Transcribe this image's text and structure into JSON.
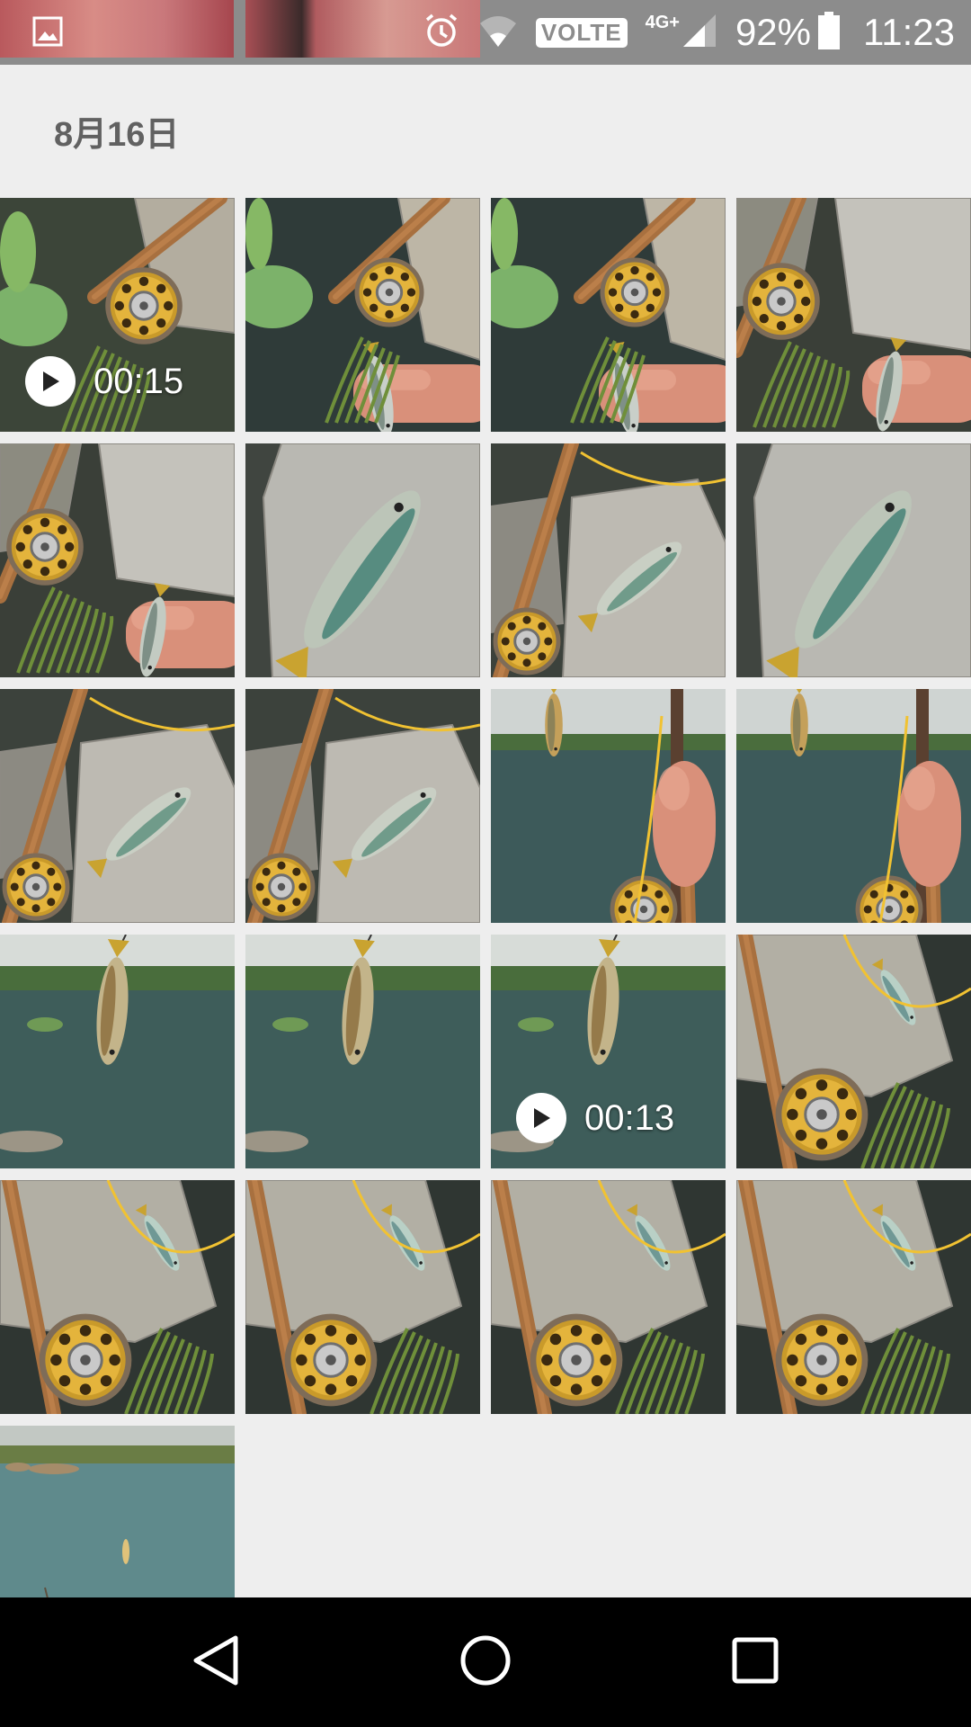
{
  "status_bar": {
    "left_icon": "image-icon",
    "volte_label": "VOLTE",
    "network_label": "4G+",
    "battery_percent": "92%",
    "time": "11:23",
    "icons": [
      "alarm-icon",
      "wifi-icon",
      "signal-icon",
      "battery-icon"
    ]
  },
  "gallery": {
    "date_header": "8月16日",
    "photos": [
      {
        "scene": "reel-plants",
        "video": true,
        "duration": "00:15"
      },
      {
        "scene": "reel-hand",
        "video": false,
        "duration": ""
      },
      {
        "scene": "reel-hand",
        "video": false,
        "duration": ""
      },
      {
        "scene": "reel-rock-hand",
        "video": false,
        "duration": ""
      },
      {
        "scene": "reel-rock-hand",
        "video": false,
        "duration": ""
      },
      {
        "scene": "fish-on-rock",
        "video": false,
        "duration": ""
      },
      {
        "scene": "rod-fish-rock",
        "video": false,
        "duration": ""
      },
      {
        "scene": "fish-on-rock",
        "video": false,
        "duration": ""
      },
      {
        "scene": "rod-fish-rock",
        "video": false,
        "duration": ""
      },
      {
        "scene": "rod-fish-rock",
        "video": false,
        "duration": ""
      },
      {
        "scene": "river-rod-hand",
        "video": false,
        "duration": ""
      },
      {
        "scene": "river-rod-hand",
        "video": false,
        "duration": ""
      },
      {
        "scene": "river-hanging-fish",
        "video": false,
        "duration": ""
      },
      {
        "scene": "river-hanging-fish",
        "video": false,
        "duration": ""
      },
      {
        "scene": "river-hanging-fish",
        "video": true,
        "duration": "00:13"
      },
      {
        "scene": "reel-rock-small-fish",
        "video": false,
        "duration": ""
      },
      {
        "scene": "reel-rock-small-fish",
        "video": false,
        "duration": ""
      },
      {
        "scene": "reel-rock-small-fish",
        "video": false,
        "duration": ""
      },
      {
        "scene": "reel-rock-small-fish",
        "video": false,
        "duration": ""
      },
      {
        "scene": "reel-rock-small-fish",
        "video": false,
        "duration": ""
      },
      {
        "scene": "river-wide",
        "video": false,
        "duration": ""
      }
    ]
  },
  "nav_bar": {
    "buttons": [
      "back-icon",
      "home-icon",
      "recents-icon"
    ]
  },
  "colors": {
    "background": "#eeeeee",
    "status_bar": "#8c8c8c",
    "nav_bar": "#000000",
    "header_text": "#616161"
  }
}
